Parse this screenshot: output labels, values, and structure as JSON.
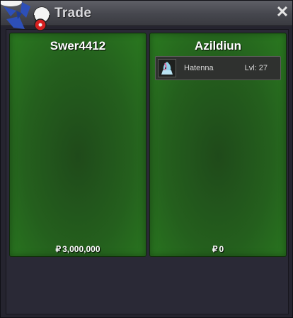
{
  "window": {
    "title": "Trade",
    "close_label": "✕"
  },
  "left_player": {
    "name": "Swer4412",
    "currency_symbol": "₽",
    "money": "3,000,000",
    "items": []
  },
  "right_player": {
    "name": "Azildiun",
    "currency_symbol": "₽",
    "money": "0",
    "items": [
      {
        "name": "Hatenna",
        "level": "Lvl: 27",
        "icon": "hatenna-sprite-icon"
      }
    ]
  },
  "colors": {
    "panel_green": "#245f1d",
    "titlebar": "#4a4b52",
    "background": "#2a2936"
  }
}
